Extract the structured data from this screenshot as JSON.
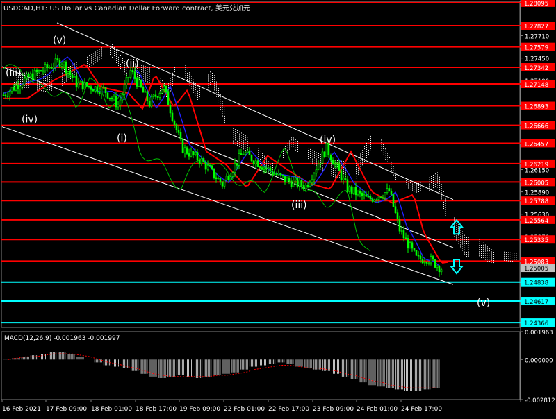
{
  "window": {
    "title": "USDCAD,H1:  US Dollar vs Canadian Dollar Forward contract",
    "title_suffix": "美元兑加元"
  },
  "colors": {
    "background": "#000000",
    "candle": "#00ff00",
    "resistance_line": "#ff0000",
    "support_line": "#00ffff",
    "channel_line": "#ffffff",
    "ma_red": "#ff0000",
    "ma_blue": "#2020ff",
    "chikou_green": "#00c000",
    "price_label_red": "#ff0000",
    "price_label_cyan": "#00ffff",
    "current_price_bg": "#c0c0c0",
    "arrow_cyan": "#00ffff",
    "macd_signal": "#ff0000",
    "macd_hist": "#c0c0c0"
  },
  "chart_data": [
    {
      "type": "candlestick",
      "symbol": "USDCAD",
      "timeframe": "H1",
      "title": "USDCAD,H1:  US Dollar vs Canadian Dollar Forward contract",
      "x_labels": [
        "16 Feb 2021",
        "17 Feb 09:00",
        "18 Feb 01:00",
        "18 Feb 17:00",
        "19 Feb 09:00",
        "22 Feb 01:00",
        "22 Feb 17:00",
        "23 Feb 09:00",
        "24 Feb 01:00",
        "24 Feb 17:00"
      ],
      "ylim": [
        1.2431,
        1.2811
      ],
      "y_axis_ticks": [
        1.2771,
        1.2745,
        1.2719,
        1.2615,
        1.2589,
        1.2563,
        1.2537,
        1.2511
      ],
      "current_price": 1.25005,
      "resistance_levels": [
        1.28095,
        1.27827,
        1.27579,
        1.27342,
        1.27148,
        1.26893,
        1.26666,
        1.26457,
        1.26219,
        1.26005,
        1.25788,
        1.25564,
        1.25335,
        1.25083
      ],
      "support_levels": [
        1.24838,
        1.24617,
        1.24366
      ],
      "wave_labels": [
        {
          "text": "(v)",
          "x": "17 Feb 09:00",
          "y": 1.2762
        },
        {
          "text": "(iii)",
          "x": "16 Feb 2021",
          "y": 1.2724
        },
        {
          "text": "(ii)",
          "x": "18 Feb 17:00",
          "y": 1.2735
        },
        {
          "text": "(iv)",
          "x": "16 Feb 2021",
          "y": 1.267
        },
        {
          "text": "(i)",
          "x": "18 Feb 01:00",
          "y": 1.2648
        },
        {
          "text": "(iv)",
          "x": "23 Feb 09:00",
          "y": 1.2646
        },
        {
          "text": "(iii)",
          "x": "22 Feb 17:00",
          "y": 1.257
        },
        {
          "text": "(v)",
          "x": "24 Feb 17:00",
          "y": 1.2456
        }
      ],
      "trend_channel": {
        "upper": {
          "from": [
            "17 Feb 09:00",
            1.2786
          ],
          "to": [
            "24 Feb 17:00",
            1.258
          ]
        },
        "middle": {
          "from": [
            "16 Feb 2021",
            1.2735
          ],
          "to": [
            "24 Feb 17:00",
            1.2524
          ]
        },
        "lower": {
          "from": [
            "16 Feb 2021",
            1.2665
          ],
          "to": [
            "24 Feb 17:00",
            1.2481
          ]
        }
      },
      "arrows": [
        {
          "direction": "up",
          "price": 1.2548
        },
        {
          "direction": "down",
          "price": 1.2502
        }
      ]
    },
    {
      "type": "bar",
      "indicator": "MACD(12,26,9) -0.001963 -0.001997",
      "label_params": "MACD(12,26,9)",
      "label_values": "-0.001963 -0.001997",
      "ylim": [
        -0.002812,
        0.001963
      ],
      "y_ticks": [
        0.001963,
        0.0,
        -0.002812
      ],
      "histogram": [
        5e-05,
        0.0001,
        0.0002,
        0.0003,
        0.0004,
        0.0005,
        0.0005,
        0.0004,
        0.0002,
        0.0,
        -0.0002,
        -0.0004,
        -0.0005,
        -0.0006,
        -0.0008,
        -0.001,
        -0.0012,
        -0.0013,
        -0.0012,
        -0.0011,
        -0.0012,
        -0.0013,
        -0.0012,
        -0.0011,
        -0.001,
        -0.0009,
        -0.0007,
        -0.0005,
        -0.0004,
        -0.0003,
        -0.0002,
        -0.0003,
        -0.0005,
        -0.0006,
        -0.0007,
        -0.0008,
        -0.001,
        -0.0012,
        -0.0014,
        -0.0016,
        -0.0018,
        -0.0019,
        -0.002,
        -0.0021,
        -0.0022,
        -0.0022,
        -0.0021,
        -0.002
      ],
      "signal": [
        0.0,
        0.0001,
        0.0002,
        0.0002,
        0.0003,
        0.0004,
        0.0004,
        0.0004,
        0.0003,
        0.0002,
        0.0,
        -0.0002,
        -0.0003,
        -0.0005,
        -0.0006,
        -0.0008,
        -0.001,
        -0.0011,
        -0.0012,
        -0.0012,
        -0.0012,
        -0.0012,
        -0.0012,
        -0.0011,
        -0.0011,
        -0.001,
        -0.0009,
        -0.0007,
        -0.0006,
        -0.0005,
        -0.0004,
        -0.0004,
        -0.0005,
        -0.0006,
        -0.0006,
        -0.0007,
        -0.0008,
        -0.001,
        -0.0011,
        -0.0013,
        -0.0015,
        -0.0016,
        -0.0018,
        -0.0019,
        -0.002,
        -0.002,
        -0.002,
        -0.002
      ]
    }
  ]
}
